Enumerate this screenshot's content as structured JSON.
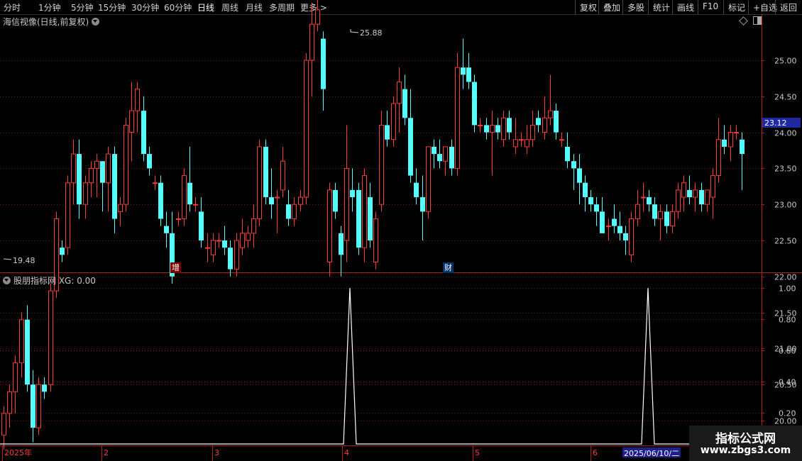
{
  "toolbar": {
    "periods": [
      "分时",
      "1分钟",
      "5分钟",
      "15分钟",
      "30分钟",
      "60分钟",
      "日线",
      "周线",
      "月线",
      "多周期",
      "更多 >"
    ],
    "active_period": "日线",
    "right_buttons": [
      "复权",
      "叠加",
      "多股",
      "统计",
      "画线",
      "F10",
      "标记",
      "+自选",
      "返回"
    ]
  },
  "main_chart": {
    "title": "海信视像(日线,前复权)",
    "high_label": "25.88",
    "low_label": "19.48",
    "current_price": "23.12",
    "axis_labels": [
      "25.00",
      "24.50",
      "24.00",
      "23.50",
      "23.00",
      "22.50",
      "22.00",
      "21.50",
      "21.00",
      "20.50",
      "20.00"
    ],
    "event_tags": [
      "增",
      "财"
    ]
  },
  "indicator": {
    "title": "股朋指标网 XG: 0.00",
    "axis_labels": [
      "1.00",
      "0.80",
      "0.60",
      "0.40",
      "0.20"
    ]
  },
  "time_axis": {
    "labels": [
      "2025年",
      "2",
      "3",
      "4",
      "5",
      "6"
    ],
    "selected_date": "2025/06/10/二"
  },
  "watermark": {
    "title": "指标公式网",
    "url": "www.zbgs3.com"
  },
  "colors": {
    "up": "#ff3b3b",
    "down": "#54ffff",
    "grid": "#7a1414",
    "axis_box": "#b02020",
    "price_highlight": "#1f2aa0"
  },
  "chart_data": {
    "type": "candlestick",
    "ylim": [
      19.4,
      26.0
    ],
    "candles": [
      [
        19.8,
        20.2,
        19.6,
        20.1
      ],
      [
        20.1,
        20.5,
        19.9,
        20.4
      ],
      [
        20.4,
        20.9,
        20.1,
        20.8
      ],
      [
        20.8,
        21.5,
        20.6,
        21.4
      ],
      [
        21.4,
        21.6,
        20.4,
        20.5
      ],
      [
        20.5,
        20.7,
        19.7,
        19.9
      ],
      [
        19.9,
        20.6,
        19.8,
        20.5
      ],
      [
        20.5,
        20.6,
        20.3,
        20.4
      ],
      [
        20.5,
        21.9,
        20.4,
        21.8
      ],
      [
        21.8,
        22.9,
        21.7,
        22.8
      ],
      [
        22.4,
        22.5,
        22.2,
        22.3
      ],
      [
        22.4,
        23.4,
        22.3,
        23.3
      ],
      [
        23.3,
        23.9,
        23.0,
        23.7
      ],
      [
        23.7,
        23.9,
        22.8,
        23.0
      ],
      [
        23.0,
        23.4,
        22.8,
        23.3
      ],
      [
        23.3,
        23.6,
        23.1,
        23.5
      ],
      [
        23.5,
        23.7,
        23.1,
        23.6
      ],
      [
        23.6,
        23.6,
        22.9,
        23.3
      ],
      [
        23.3,
        23.8,
        22.9,
        23.7
      ],
      [
        23.7,
        23.8,
        22.6,
        22.8
      ],
      [
        22.9,
        23.1,
        22.7,
        23.0
      ],
      [
        23.0,
        24.2,
        22.9,
        24.1
      ],
      [
        24.0,
        24.7,
        23.6,
        24.3
      ],
      [
        24.3,
        24.7,
        24.0,
        24.6
      ],
      [
        24.3,
        24.5,
        23.6,
        23.7
      ],
      [
        23.7,
        23.8,
        23.4,
        23.5
      ],
      [
        23.3,
        23.4,
        23.2,
        23.3
      ],
      [
        23.3,
        23.4,
        22.7,
        22.8
      ],
      [
        22.7,
        22.9,
        22.4,
        22.6
      ],
      [
        22.6,
        22.9,
        21.9,
        22.0
      ],
      [
        22.8,
        22.9,
        22.7,
        22.8
      ],
      [
        22.8,
        23.5,
        22.7,
        23.4
      ],
      [
        23.3,
        23.8,
        22.9,
        23.0
      ],
      [
        23.0,
        23.1,
        22.9,
        23.0
      ],
      [
        22.9,
        23.1,
        22.4,
        22.5
      ],
      [
        22.4,
        22.6,
        22.2,
        22.4
      ],
      [
        22.3,
        22.6,
        22.2,
        22.5
      ],
      [
        22.5,
        22.6,
        22.4,
        22.5
      ],
      [
        22.5,
        22.7,
        22.3,
        22.4
      ],
      [
        22.4,
        22.5,
        22.0,
        22.1
      ],
      [
        22.1,
        22.6,
        22.0,
        22.5
      ],
      [
        22.4,
        22.8,
        22.3,
        22.6
      ],
      [
        22.5,
        22.7,
        22.4,
        22.6
      ],
      [
        22.6,
        23.0,
        22.4,
        22.8
      ],
      [
        22.8,
        23.9,
        22.7,
        23.8
      ],
      [
        23.8,
        23.9,
        23.0,
        23.1
      ],
      [
        23.1,
        23.5,
        22.8,
        23.0
      ],
      [
        23.1,
        23.2,
        22.6,
        23.1
      ],
      [
        23.2,
        23.8,
        23.1,
        23.6
      ],
      [
        23.0,
        23.2,
        22.7,
        22.8
      ],
      [
        22.8,
        23.1,
        22.7,
        23.0
      ],
      [
        23.0,
        23.2,
        22.9,
        23.1
      ],
      [
        23.1,
        25.1,
        23.0,
        25.0
      ],
      [
        25.0,
        25.8,
        24.5,
        25.5
      ],
      [
        25.5,
        25.9,
        25.4,
        25.7
      ],
      [
        25.3,
        25.4,
        24.3,
        24.6
      ],
      [
        22.2,
        23.3,
        22.0,
        23.2
      ],
      [
        23.2,
        23.3,
        22.8,
        22.9
      ],
      [
        22.6,
        22.7,
        22.0,
        22.3
      ],
      [
        22.5,
        24.1,
        22.2,
        23.5
      ],
      [
        23.2,
        23.5,
        22.9,
        23.1
      ],
      [
        23.2,
        23.3,
        22.3,
        22.4
      ],
      [
        22.4,
        23.5,
        22.2,
        23.4
      ],
      [
        23.1,
        23.3,
        22.4,
        22.5
      ],
      [
        22.2,
        22.9,
        22.1,
        22.8
      ],
      [
        23.0,
        24.3,
        22.9,
        24.1
      ],
      [
        24.1,
        24.3,
        23.8,
        23.9
      ],
      [
        23.9,
        24.5,
        23.8,
        24.4
      ],
      [
        24.4,
        24.9,
        24.0,
        24.7
      ],
      [
        24.6,
        24.8,
        24.1,
        24.2
      ],
      [
        24.2,
        24.6,
        23.3,
        23.4
      ],
      [
        23.3,
        23.5,
        23.0,
        23.1
      ],
      [
        23.1,
        23.4,
        22.5,
        22.9
      ],
      [
        22.9,
        23.8,
        22.8,
        23.8
      ],
      [
        23.8,
        23.9,
        23.5,
        23.7
      ],
      [
        23.7,
        23.9,
        23.5,
        23.6
      ],
      [
        23.6,
        23.8,
        23.4,
        23.8
      ],
      [
        23.8,
        23.9,
        23.4,
        23.5
      ],
      [
        23.5,
        25.1,
        23.4,
        24.9
      ],
      [
        24.9,
        25.3,
        24.6,
        24.8
      ],
      [
        24.9,
        25.1,
        24.6,
        24.7
      ],
      [
        24.7,
        24.8,
        24.0,
        24.1
      ],
      [
        24.1,
        24.2,
        24.0,
        24.1
      ],
      [
        24.1,
        24.2,
        23.9,
        24.0
      ],
      [
        24.0,
        24.3,
        23.4,
        24.1
      ],
      [
        24.1,
        24.2,
        23.9,
        24.0
      ],
      [
        23.9,
        24.3,
        23.8,
        24.2
      ],
      [
        24.2,
        24.3,
        23.9,
        24.0
      ],
      [
        23.8,
        24.2,
        23.7,
        23.9
      ],
      [
        23.9,
        24.0,
        23.8,
        23.9
      ],
      [
        23.8,
        24.1,
        23.7,
        23.9
      ],
      [
        23.9,
        24.3,
        23.8,
        24.1
      ],
      [
        24.2,
        24.3,
        24.0,
        24.1
      ],
      [
        24.0,
        24.5,
        23.9,
        24.2
      ],
      [
        24.2,
        24.8,
        24.1,
        24.3
      ],
      [
        24.3,
        24.4,
        23.9,
        24.0
      ],
      [
        23.9,
        24.0,
        23.8,
        23.9
      ],
      [
        23.8,
        24.0,
        23.5,
        23.6
      ],
      [
        23.6,
        23.7,
        23.2,
        23.5
      ],
      [
        23.5,
        23.7,
        23.0,
        23.3
      ],
      [
        23.3,
        23.4,
        22.9,
        23.1
      ],
      [
        23.1,
        23.2,
        22.9,
        23.0
      ],
      [
        23.0,
        23.1,
        22.7,
        22.9
      ],
      [
        22.9,
        23.1,
        22.6,
        22.6
      ],
      [
        22.7,
        22.8,
        22.5,
        22.7
      ],
      [
        22.8,
        23.0,
        22.6,
        22.7
      ],
      [
        22.7,
        22.9,
        22.5,
        22.6
      ],
      [
        22.6,
        22.7,
        22.3,
        22.5
      ],
      [
        22.3,
        22.9,
        22.2,
        22.8
      ],
      [
        22.8,
        23.2,
        22.7,
        23.0
      ],
      [
        23.1,
        23.3,
        22.9,
        23.1
      ],
      [
        23.1,
        23.2,
        22.9,
        23.0
      ],
      [
        23.0,
        23.1,
        22.7,
        22.8
      ],
      [
        22.8,
        23.0,
        22.5,
        22.9
      ],
      [
        22.9,
        23.0,
        22.6,
        22.7
      ],
      [
        22.7,
        23.0,
        22.6,
        22.9
      ],
      [
        22.9,
        23.3,
        22.8,
        23.2
      ],
      [
        23.1,
        23.4,
        22.9,
        23.3
      ],
      [
        23.2,
        23.4,
        23.0,
        23.1
      ],
      [
        23.1,
        23.3,
        22.9,
        23.2
      ],
      [
        23.2,
        23.3,
        22.9,
        23.0
      ],
      [
        23.0,
        23.2,
        22.9,
        23.2
      ],
      [
        23.1,
        23.5,
        22.8,
        23.4
      ],
      [
        23.4,
        24.2,
        23.3,
        23.9
      ],
      [
        23.9,
        24.1,
        23.7,
        23.8
      ],
      [
        23.8,
        24.1,
        23.6,
        24.0
      ],
      [
        24.0,
        24.1,
        23.9,
        24.0
      ],
      [
        23.9,
        24.0,
        23.2,
        23.7
      ]
    ],
    "xg_signals": [
      0,
      0,
      1,
      0,
      0,
      1
    ]
  }
}
